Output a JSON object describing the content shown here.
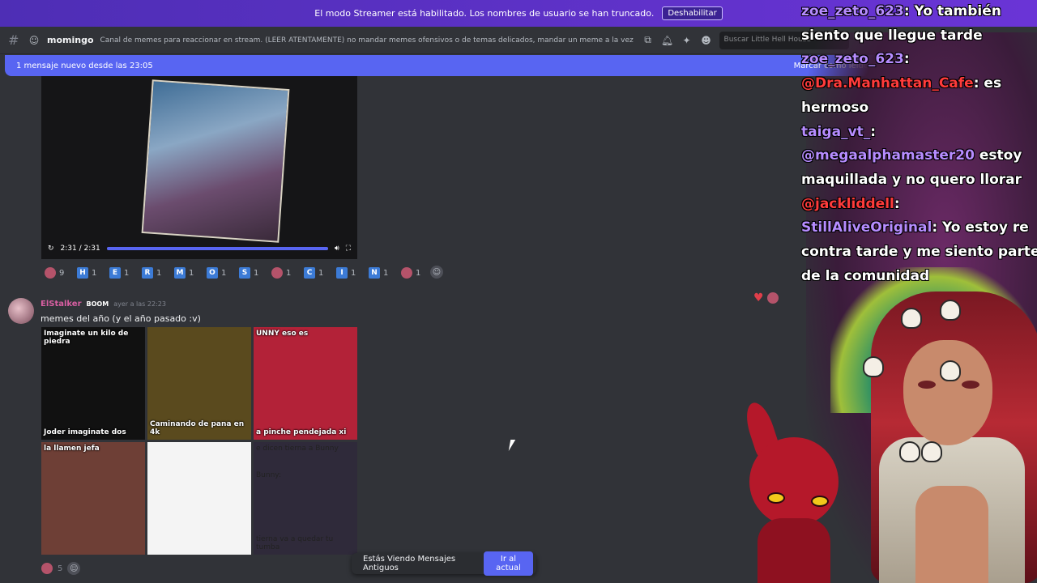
{
  "streamer_bar": {
    "message": "El modo Streamer está habilitado. Los nombres de usuario se han truncado.",
    "button": "Deshabilitar"
  },
  "header": {
    "channel_name": "momingo",
    "topic": "Canal de memes para reaccionar en stream. (LEER ATENTAMENTE) no mandar memes ofensivos o de temas delicados, mandar un meme a la vez , ver qu...",
    "search_placeholder": "Buscar Little Hell House"
  },
  "new_messages": {
    "text": "1 mensaje nuevo desde las 23:05",
    "mark_read": "Marcar como leído"
  },
  "video": {
    "time": "2:31 / 2:31",
    "progress": 1.0
  },
  "reactions": [
    {
      "kind": "emoji",
      "count": "9"
    },
    {
      "kind": "letter",
      "letter": "H",
      "count": "1"
    },
    {
      "kind": "letter",
      "letter": "E",
      "count": "1"
    },
    {
      "kind": "letter",
      "letter": "R",
      "count": "1"
    },
    {
      "kind": "letter",
      "letter": "M",
      "count": "1"
    },
    {
      "kind": "letter",
      "letter": "O",
      "count": "1"
    },
    {
      "kind": "letter",
      "letter": "S",
      "count": "1"
    },
    {
      "kind": "emoji",
      "count": "1"
    },
    {
      "kind": "letter",
      "letter": "C",
      "count": "1"
    },
    {
      "kind": "letter",
      "letter": "I",
      "count": "1"
    },
    {
      "kind": "letter",
      "letter": "N",
      "count": "1"
    },
    {
      "kind": "emoji",
      "count": "1"
    }
  ],
  "message": {
    "author": "ElStalker",
    "role": "BOOM",
    "timestamp": "ayer a las 22:23",
    "text": "memes del año (y el año pasado :v)"
  },
  "gallery": [
    {
      "top": "Imaginate un kilo de piedra",
      "bottom": "Joder imaginate dos",
      "bg": "#111111",
      "dark": false
    },
    {
      "top": "",
      "bottom": "Caminando de pana en 4k",
      "bg": "#5a4a1e",
      "dark": false
    },
    {
      "top": "UNNY  eso es",
      "bottom": "a pinche pendejada xi",
      "bg": "#b32238",
      "dark": false
    },
    {
      "top": "la llamen jefa",
      "bottom": "",
      "bg": "#6e3f36",
      "dark": true
    },
    {
      "top": "",
      "bottom": "",
      "bg": "#f4f4f4",
      "dark": true
    },
    {
      "top": "e dicen tierna a Bunny",
      "mid": "Bunny:",
      "bottom": "tierna va a quedar tu tumba",
      "bg": "#2f2a3a",
      "dark": true
    }
  ],
  "bottom_reaction_count": "5",
  "old_messages": {
    "text": "Estás Viendo Mensajes Antiguos",
    "button": "Ir al actual"
  },
  "chat_overlay": [
    {
      "user": "zoe_zeto_623",
      "text": ": Yo también siento que llegue tarde",
      "color": "purple"
    },
    {
      "user": "zoe_zeto_623",
      "text": ":",
      "color": "purple"
    },
    {
      "user": "@Dra.Manhattan_Cafe",
      "text": ": es hermoso",
      "color": "red"
    },
    {
      "user": "taiga_vt_",
      "text": ":",
      "color": "purple"
    },
    {
      "user": "@megaalphamaster20",
      "text": " estoy maquillada y no quero llorar",
      "color": "purple"
    },
    {
      "user": "@jackliddell",
      "text": ":",
      "color": "red"
    },
    {
      "user": "StillAliveOriginal",
      "text": ": Yo estoy re contra tarde y me siento parte de la comunidad",
      "color": "purple"
    }
  ],
  "colors": {
    "accent": "#5865f2",
    "streamer_bar": "#5b30c8",
    "background": "#313338"
  }
}
